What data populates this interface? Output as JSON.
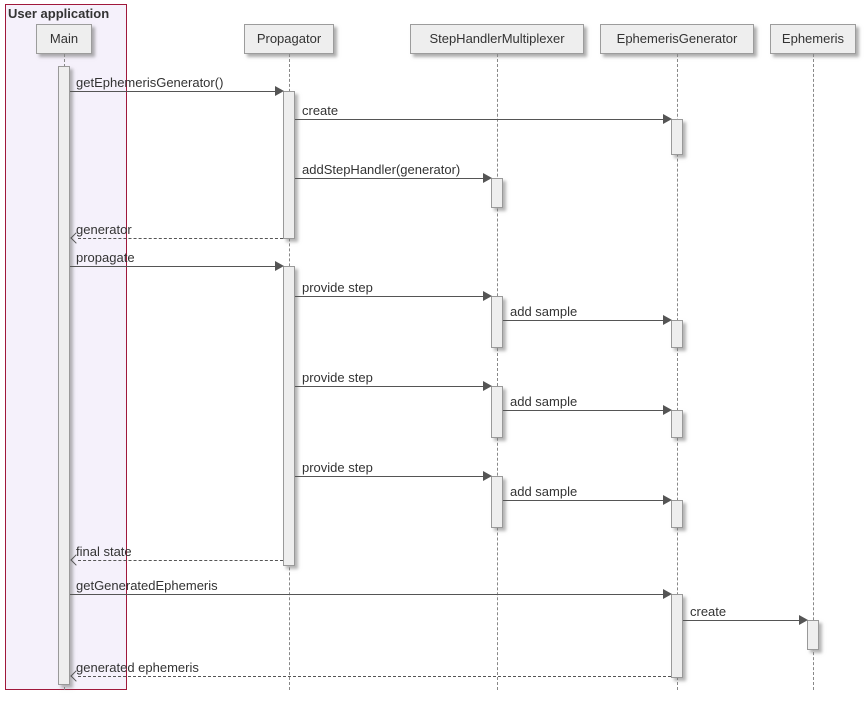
{
  "box": {
    "label": "User application"
  },
  "participants": {
    "main": "Main",
    "propagator": "Propagator",
    "multiplexer": "StepHandlerMultiplexer",
    "generator": "EphemerisGenerator",
    "ephemeris": "Ephemeris"
  },
  "messages": {
    "getGen": "getEphemerisGenerator()",
    "create1": "create",
    "addHandler": "addStepHandler(generator)",
    "retGen": "generator",
    "propagate": "propagate",
    "provide1": "provide step",
    "addSample1": "add sample",
    "provide2": "provide step",
    "addSample2": "add sample",
    "provide3": "provide step",
    "addSample3": "add sample",
    "finalState": "final state",
    "getEph": "getGeneratedEphemeris",
    "create2": "create",
    "retEph": "generated ephemeris"
  }
}
